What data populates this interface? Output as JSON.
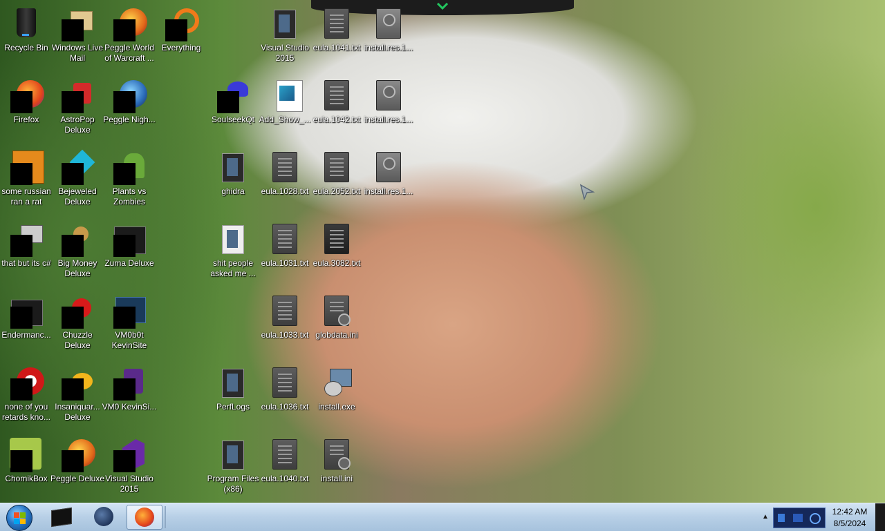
{
  "desktop": {
    "col1": [
      {
        "label": "Recycle Bin",
        "icon": "recycle-bin-icon"
      },
      {
        "label": "Firefox",
        "icon": "firefox-icon"
      },
      {
        "label": "some russian ran a rat",
        "icon": "java-icon"
      },
      {
        "label": "that but its c#",
        "icon": "stacked-windows-icon"
      },
      {
        "label": "Endermanc...",
        "icon": "console-window-icon"
      },
      {
        "label": "none of you retards kno...",
        "icon": "red-disc-icon"
      },
      {
        "label": "ChomikBox",
        "icon": "hamster-icon"
      }
    ],
    "col2": [
      {
        "label": "Windows Live Mail",
        "icon": "envelope-icon"
      },
      {
        "label": "AstroPop Deluxe",
        "icon": "astropop-icon"
      },
      {
        "label": "Bejeweled Deluxe",
        "icon": "gem-icon"
      },
      {
        "label": "Big Money Deluxe",
        "icon": "money-bag-icon"
      },
      {
        "label": "Chuzzle Deluxe",
        "icon": "chuzzle-icon"
      },
      {
        "label": "Insaniquar... Deluxe",
        "icon": "fish-icon"
      },
      {
        "label": "Peggle Deluxe",
        "icon": "peggle-ball-icon"
      }
    ],
    "col3": [
      {
        "label": "Peggle World of Warcraft ...",
        "icon": "peggle-ball-icon"
      },
      {
        "label": "Peggle Nigh...",
        "icon": "peggle-moon-icon"
      },
      {
        "label": "Plants vs Zombies",
        "icon": "plant-icon"
      },
      {
        "label": "Zuma Deluxe",
        "icon": "console-window-icon"
      },
      {
        "label": "VM0b0t KevinSite",
        "icon": "vm-icon"
      },
      {
        "label": "VM0 KevinSi...",
        "icon": "vm-purple-icon"
      },
      {
        "label": "Visual Studio 2015",
        "icon": "visual-studio-icon"
      }
    ],
    "col4": [
      {
        "label": "Everything",
        "icon": "magnifier-icon"
      }
    ],
    "col5": [
      {
        "label": "SoulseekQt",
        "icon": "bird-icon"
      },
      {
        "label": "ghidra",
        "icon": "folder-icon"
      },
      {
        "label": "shit people asked me ...",
        "icon": "folder-icon"
      },
      {
        "label": "PerfLogs",
        "icon": "folder-icon"
      },
      {
        "label": "Program Files (x86)",
        "icon": "folder-icon"
      }
    ],
    "col6": [
      {
        "label": "Visual Studio 2015",
        "icon": "folder-icon"
      },
      {
        "label": "Add_Show_...",
        "icon": "registry-icon"
      },
      {
        "label": "eula.1028.txt",
        "icon": "text-file-icon"
      },
      {
        "label": "eula.1031.txt",
        "icon": "text-file-icon"
      },
      {
        "label": "eula.1033.txt",
        "icon": "text-file-icon"
      },
      {
        "label": "eula.1036.txt",
        "icon": "text-file-icon"
      },
      {
        "label": "eula.1040.txt",
        "icon": "text-file-icon"
      }
    ],
    "col7": [
      {
        "label": "eula.1041.txt",
        "icon": "text-file-icon"
      },
      {
        "label": "eula.1042.txt",
        "icon": "text-file-icon"
      },
      {
        "label": "eula.2052.txt",
        "icon": "text-file-icon"
      },
      {
        "label": "eula.3082.txt",
        "icon": "text-file-icon"
      },
      {
        "label": "globdata.ini",
        "icon": "settings-file-icon"
      },
      {
        "label": "install.exe",
        "icon": "installer-icon"
      },
      {
        "label": "install.ini",
        "icon": "settings-file-icon"
      }
    ],
    "col8": [
      {
        "label": "install.res.1...",
        "icon": "resource-file-icon"
      },
      {
        "label": "install.res.1...",
        "icon": "resource-file-icon"
      },
      {
        "label": "install.res.1...",
        "icon": "resource-file-icon"
      }
    ]
  },
  "taskbar": {
    "pinned": [
      "black-window-icon",
      "dark-globe-icon",
      "firefox-icon"
    ],
    "active": "firefox-icon",
    "clock_time": "12:42 AM",
    "clock_date": "8/5/2024",
    "tray_arrow": "▲"
  }
}
